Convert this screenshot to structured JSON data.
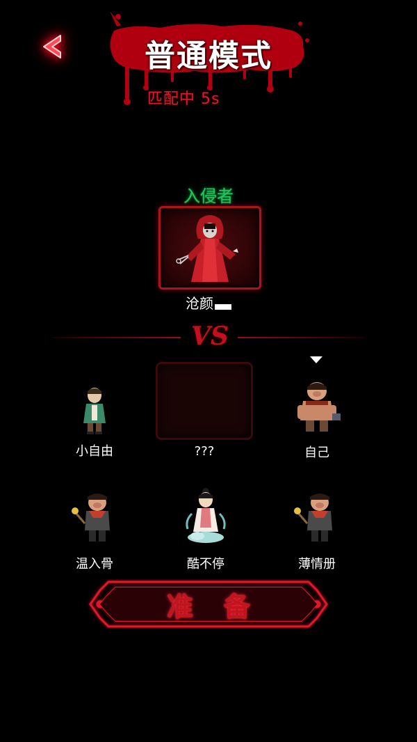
{
  "header": {
    "back_icon": "chevron-left-icon",
    "title": "普通模式",
    "match_status": "匹配中 5s"
  },
  "invader": {
    "label": "入侵者",
    "name": "沧颜",
    "portrait": "red-robed-ghost-woman"
  },
  "divider": {
    "vs": "VS"
  },
  "survivors": [
    {
      "name": "小自由",
      "avatar": "boy-green-jacket"
    },
    {
      "name": "???",
      "avatar": "empty"
    },
    {
      "name": "自己",
      "avatar": "pig-warrior-buff",
      "is_self": true
    },
    {
      "name": "温入骨",
      "avatar": "pig-warrior-torch"
    },
    {
      "name": "酷不停",
      "avatar": "fairy-girl-cloud"
    },
    {
      "name": "薄情册",
      "avatar": "pig-warrior-torch"
    }
  ],
  "ready_button": {
    "label": "准备"
  },
  "colors": {
    "accent_red": "#c0141e",
    "invader_green": "#23c45c",
    "background": "#000000"
  }
}
